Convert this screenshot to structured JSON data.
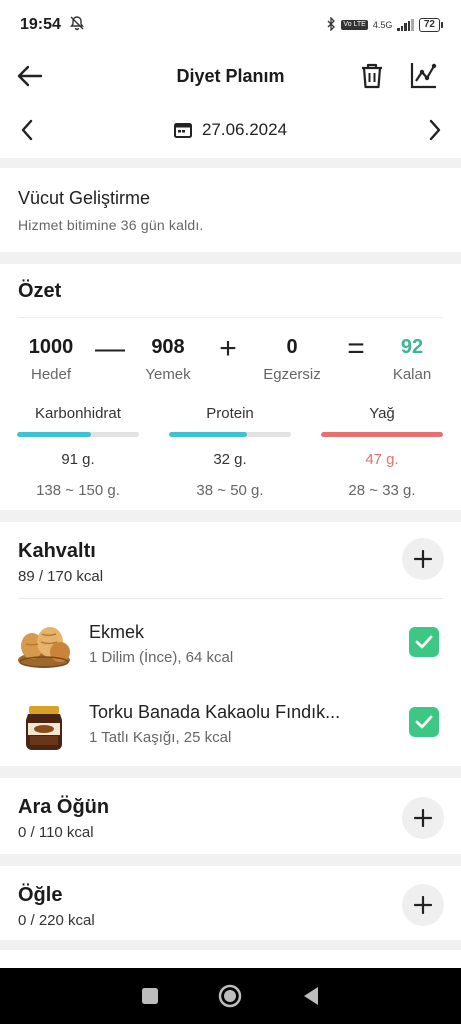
{
  "status_bar": {
    "time": "19:54",
    "battery": "72",
    "network": "4.5G",
    "volte": "Vo LTE"
  },
  "header": {
    "title": "Diyet Planım"
  },
  "date_nav": {
    "date": "27.06.2024"
  },
  "service": {
    "title": "Vücut Geliştirme",
    "subtitle": "Hizmet bitimine 36 gün kaldı."
  },
  "summary": {
    "title": "Özet",
    "goal": {
      "value": "1000",
      "label": "Hedef"
    },
    "food": {
      "value": "908",
      "label": "Yemek"
    },
    "exercise": {
      "value": "0",
      "label": "Egzersiz"
    },
    "remaining": {
      "value": "92",
      "label": "Kalan"
    },
    "ops": {
      "minus": "—",
      "plus": "+",
      "equals": "="
    },
    "macros": [
      {
        "name": "Karbonhidrat",
        "amount": "91 g.",
        "range": "138 ~ 150 g.",
        "fill": 0.61,
        "color": "#3ec1d3",
        "over": false
      },
      {
        "name": "Protein",
        "amount": "32 g.",
        "range": "38 ~ 50 g.",
        "fill": 0.64,
        "color": "#3ec1d3",
        "over": false
      },
      {
        "name": "Yağ",
        "amount": "47 g.",
        "range": "28 ~ 33 g.",
        "fill": 1.0,
        "color": "#e9706f",
        "over": true
      }
    ]
  },
  "meals": {
    "breakfast": {
      "title": "Kahvaltı",
      "kcal": "89 / 170 kcal",
      "items": [
        {
          "name": "Ekmek",
          "detail": "1 Dilim (İnce), 64 kcal"
        },
        {
          "name": "Torku Banada Kakaolu Fındık...",
          "detail": "1 Tatlı Kaşığı, 25 kcal"
        }
      ]
    },
    "snack": {
      "title": "Ara Öğün",
      "kcal": "0 / 110 kcal"
    },
    "lunch": {
      "title": "Öğle",
      "kcal": "0 / 220 kcal"
    }
  },
  "colors": {
    "accent_green": "#3cc884",
    "remaining_teal": "#3cb596",
    "bar_blue": "#3ec1d3",
    "bar_red": "#e9706f"
  }
}
